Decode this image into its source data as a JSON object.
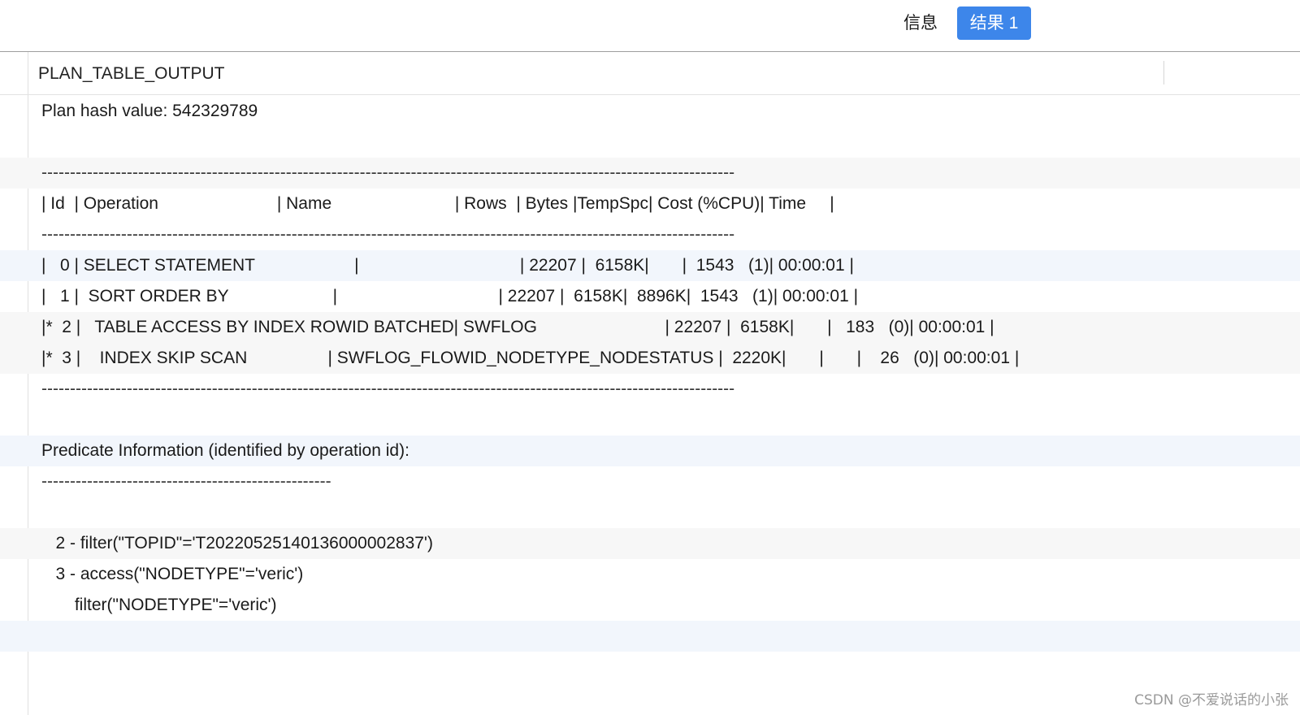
{
  "tabs": {
    "info_label": "信息",
    "result_label": "结果 1"
  },
  "grid": {
    "column_header": "PLAN_TABLE_OUTPUT",
    "rows": [
      "Plan hash value: 542329789",
      "",
      "--------------------------------------------------------------------------------------------------------------------------",
      "| Id  | Operation                         | Name                          | Rows  | Bytes |TempSpc| Cost (%CPU)| Time     |",
      "--------------------------------------------------------------------------------------------------------------------------",
      "|   0 | SELECT STATEMENT                     |                                  | 22207 |  6158K|       |  1543   (1)| 00:00:01 |",
      "|   1 |  SORT ORDER BY                      |                                  | 22207 |  6158K|  8896K|  1543   (1)| 00:00:01 |",
      "|*  2 |   TABLE ACCESS BY INDEX ROWID BATCHED| SWFLOG                           | 22207 |  6158K|       |   183   (0)| 00:00:01 |",
      "|*  3 |    INDEX SKIP SCAN                 | SWFLOG_FLOWID_NODETYPE_NODESTATUS |  2220K|       |       |    26   (0)| 00:00:01 |",
      "--------------------------------------------------------------------------------------------------------------------------",
      "",
      "Predicate Information (identified by operation id):",
      "---------------------------------------------------",
      "",
      "   2 - filter(\"TOPID\"='T20220525140136000002837')",
      "   3 - access(\"NODETYPE\"='veric')",
      "       filter(\"NODETYPE\"='veric')",
      ""
    ]
  },
  "watermark": "CSDN @不爱说话的小张",
  "colors": {
    "accent": "#3d86ea",
    "row_alt_gray": "#f7f7f7",
    "row_alt_blue": "#f2f6fc"
  }
}
